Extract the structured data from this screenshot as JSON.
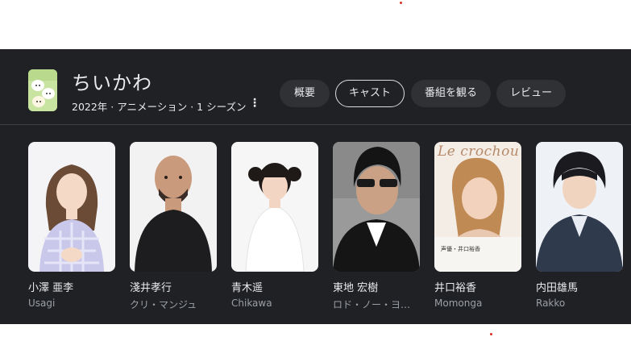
{
  "show": {
    "title": "ちいかわ",
    "subtitle": "2022年 · アニメーション · 1 シーズン",
    "more_icon": "more-vert-icon"
  },
  "chips": [
    {
      "label": "概要",
      "selected": false
    },
    {
      "label": "キャスト",
      "selected": true
    },
    {
      "label": "番組を観る",
      "selected": false
    },
    {
      "label": "レビュー",
      "selected": false
    }
  ],
  "cast": [
    {
      "name": "小澤 亜李",
      "role": "Usagi"
    },
    {
      "name": "淺井孝行",
      "role": "クリ・マンジュ"
    },
    {
      "name": "青木遥",
      "role": "Chikawa"
    },
    {
      "name": "東地 宏樹",
      "role": "ロド・ノー・ヨ…"
    },
    {
      "name": "井口裕香",
      "role": "Momonga",
      "photo_text": "Le crochou",
      "photo_caption": "声優・井口裕香"
    },
    {
      "name": "内田雄馬",
      "role": "Rakko"
    }
  ],
  "colors": {
    "panel_bg": "#202124",
    "chip_bg": "#303134",
    "text_primary": "#e8eaed",
    "text_secondary": "#9aa0a6",
    "accent_dot": "#d93025"
  }
}
